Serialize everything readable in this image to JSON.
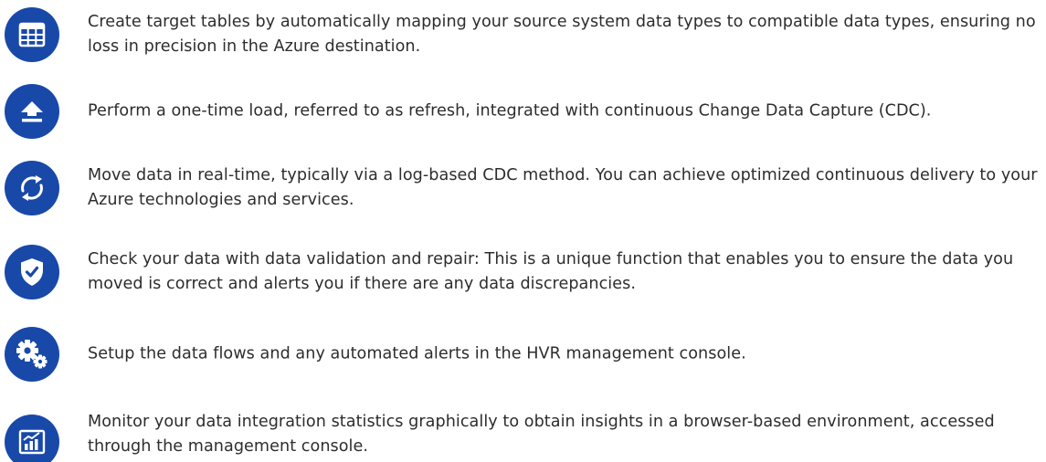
{
  "colors": {
    "icon_background": "#1849a9",
    "icon_foreground": "#ffffff",
    "text": "#2d2d2d"
  },
  "features": [
    {
      "icon": "table-icon",
      "text": "Create target tables by automatically mapping your source system data types to compatible data types, ensuring no loss in precision in the Azure destination."
    },
    {
      "icon": "upload-icon",
      "text": "Perform a one-time load, referred to as refresh, integrated with continuous Change Data Capture (CDC)."
    },
    {
      "icon": "sync-icon",
      "text": "Move data in real-time, typically via a log-based CDC method. You can achieve optimized continuous delivery to your Azure technologies and services."
    },
    {
      "icon": "shield-check-icon",
      "text": "Check your data with data validation and repair: This is a unique function that enables you to ensure the data you moved is correct and alerts you if there are any data discrepancies."
    },
    {
      "icon": "gears-icon",
      "text": "Setup the data flows and any automated alerts in the HVR management console."
    },
    {
      "icon": "bar-chart-icon",
      "text": "Monitor your data integration statistics graphically to obtain insights in a browser-based environment, accessed through the management console."
    }
  ]
}
